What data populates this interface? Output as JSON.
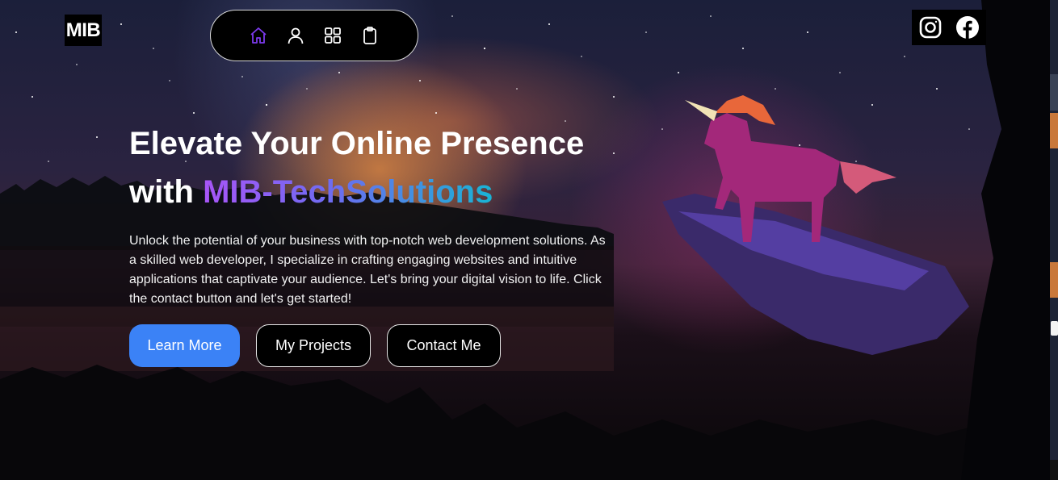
{
  "header": {
    "logo_text": "MIB",
    "nav": [
      {
        "icon": "home-icon",
        "active": true
      },
      {
        "icon": "user-icon",
        "active": false
      },
      {
        "icon": "grid-icon",
        "active": false
      },
      {
        "icon": "clipboard-icon",
        "active": false
      }
    ],
    "social": [
      {
        "icon": "instagram-icon"
      },
      {
        "icon": "facebook-icon"
      }
    ]
  },
  "hero": {
    "headline_line1": "Elevate Your Online Presence",
    "headline_prefix": "with",
    "brand_name": "MIB-TechSolutions",
    "description": "Unlock the potential of your business with top-notch web development solutions. As a skilled web developer, I specialize in crafting engaging websites and intuitive applications that captivate your audience. Let's bring your digital vision to life. Click the contact button and let's get started!",
    "buttons": {
      "learn_more": "Learn More",
      "my_projects": "My Projects",
      "contact_me": "Contact Me"
    }
  },
  "colors": {
    "primary_button": "#3b82f6",
    "active_nav_icon": "#7c3aed",
    "brand_gradient": [
      "#a855f7",
      "#6d6cf0",
      "#18b4d4"
    ]
  }
}
